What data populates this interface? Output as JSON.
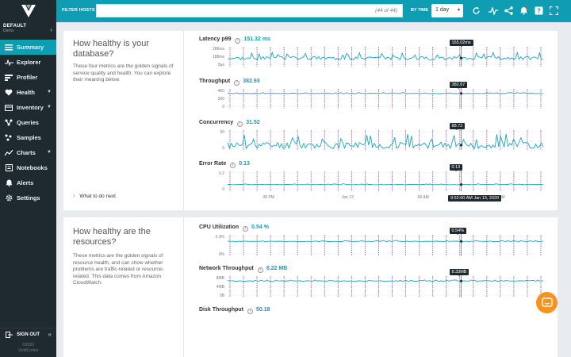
{
  "sidebar": {
    "env_name": "DEFAULT",
    "env_sub": "Demo",
    "items": [
      {
        "label": "Summary",
        "icon": "list-icon",
        "active": true
      },
      {
        "label": "Explorer",
        "icon": "pulse-icon"
      },
      {
        "label": "Profiler",
        "icon": "bars-icon"
      },
      {
        "label": "Health",
        "icon": "heart-icon",
        "caret": true
      },
      {
        "label": "Inventory",
        "icon": "box-icon",
        "caret": true
      },
      {
        "label": "Queries",
        "icon": "nodes-icon"
      },
      {
        "label": "Samples",
        "icon": "samples-icon"
      },
      {
        "label": "Charts",
        "icon": "chart-icon",
        "caret": true
      },
      {
        "label": "Notebooks",
        "icon": "notebook-icon"
      },
      {
        "label": "Alerts",
        "icon": "bell-icon"
      },
      {
        "label": "Settings",
        "icon": "gear-icon"
      }
    ],
    "signout": "SIGN OUT",
    "footer_line1": "©2020",
    "footer_line2": "VividCortex"
  },
  "topbar": {
    "filter_label": "FILTER HOSTS",
    "filter_count": "(44 of 44)",
    "bytime_label": "BY TIME",
    "time_value": "1 day",
    "accent": "#0f9db3"
  },
  "database_panel": {
    "title": "How healthy is your database?",
    "desc": "These four metrics are the golden signals of service quality and health. You can explore their meaning below.",
    "next": "What to do next",
    "metrics": [
      {
        "name": "Latency p99",
        "value": "151.32 ms",
        "tip": "165.02ms",
        "ticks": [
          "286ms",
          "188ms",
          "0μs"
        ]
      },
      {
        "name": "Throughput",
        "value": "382.93",
        "tip": "382.67",
        "ticks": [
          "400",
          "200",
          "0"
        ]
      },
      {
        "name": "Concurrency",
        "value": "31.52",
        "tip": "88.72",
        "ticks": [
          "50",
          "0"
        ]
      },
      {
        "name": "Error Rate",
        "value": "0.13",
        "tip": "0.13",
        "ticks": [
          "0.2",
          "0"
        ],
        "xlabels": [
          "06 PM",
          "Jan 13",
          "06 AM",
          "12 PM"
        ],
        "time_tip": "9:52:00 AM Jan 13, 2020"
      }
    ]
  },
  "resources_panel": {
    "title": "How healthy are the resources?",
    "desc": "These metrics are the golden signals of resource health, and can show whether problems are traffic-related or resource-related. This data comes from Amazon CloudWatch.",
    "metrics": [
      {
        "name": "CPU Utilization",
        "value": "0.54 %",
        "tip": "0.54%",
        "ticks": [
          "0.3%",
          "0%"
        ]
      },
      {
        "name": "Network Throughput",
        "value": "8.22 MB",
        "tip": "8.33MB",
        "ticks": [
          "8MB",
          "4MB",
          "0B"
        ]
      },
      {
        "name": "Disk Throughput",
        "value": "50.18"
      }
    ]
  },
  "colors": {
    "series": "#19a7bd",
    "marker": "#7a3ea0",
    "sidebar": "#1f2a30",
    "chat": "#f7931e"
  }
}
